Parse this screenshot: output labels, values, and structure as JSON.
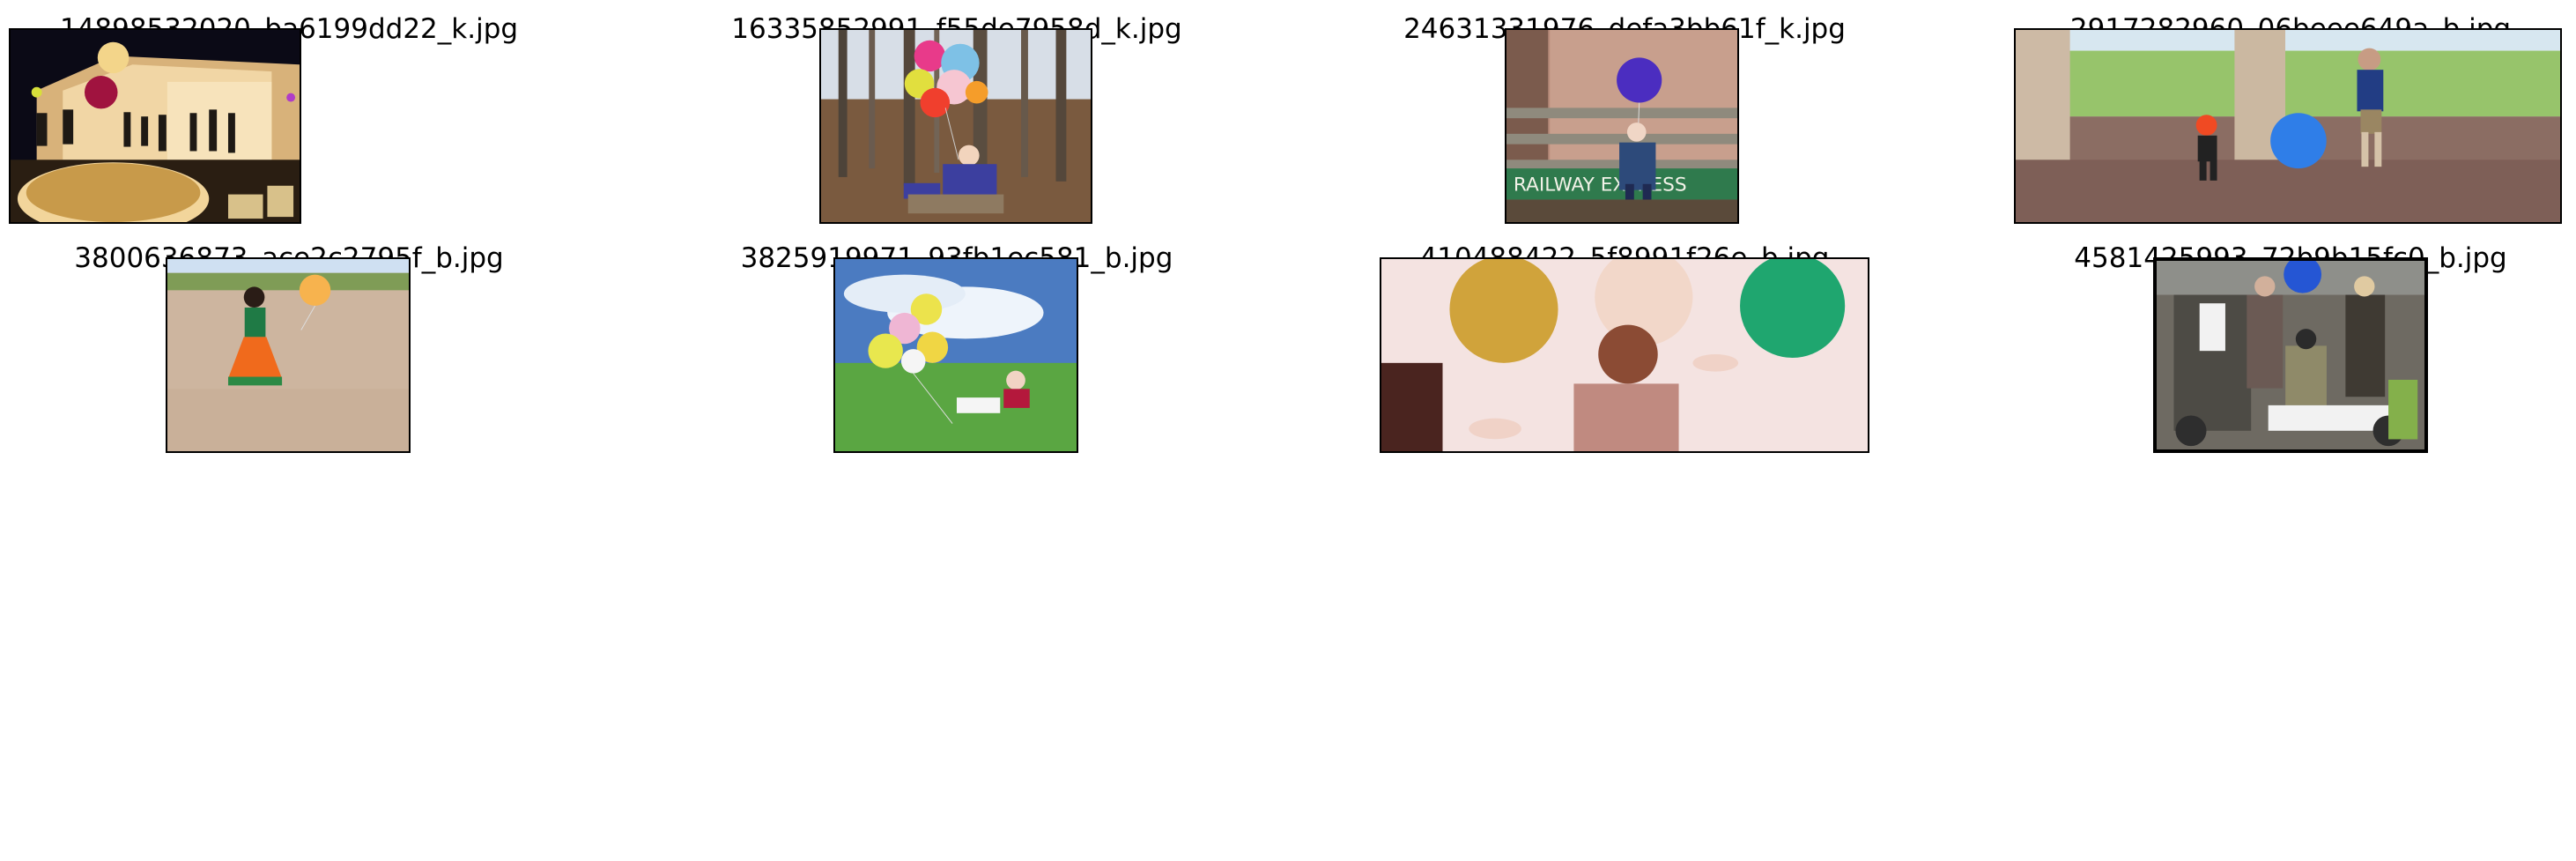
{
  "grid": {
    "rows": 2,
    "columns": 4,
    "cells": [
      {
        "title": "14898532020_ba6199dd22_k.jpg",
        "scene": "party-tent"
      },
      {
        "title": "16335852991_f55de7958d_k.jpg",
        "scene": "forest-child-balloons"
      },
      {
        "title": "24631331976_defa3bb61f_k.jpg",
        "scene": "railway-express-child"
      },
      {
        "title": "2917282960_06beee649a_b.jpg",
        "scene": "indoor-ball-play"
      },
      {
        "title": "3800636873_ace2c2795f_b.jpg",
        "scene": "girl-orange-dress"
      },
      {
        "title": "3825919971_93fb1ec581_b.jpg",
        "scene": "baby-on-grass"
      },
      {
        "title": "410488422_5f8991f26e_b.jpg",
        "scene": "woman-dancing-balloons"
      },
      {
        "title": "4581425993_72b9b15fc0_b.jpg",
        "scene": "street-scooter"
      }
    ]
  },
  "photo_text": {
    "railway_sign": "RAILWAY EXPRESS"
  }
}
